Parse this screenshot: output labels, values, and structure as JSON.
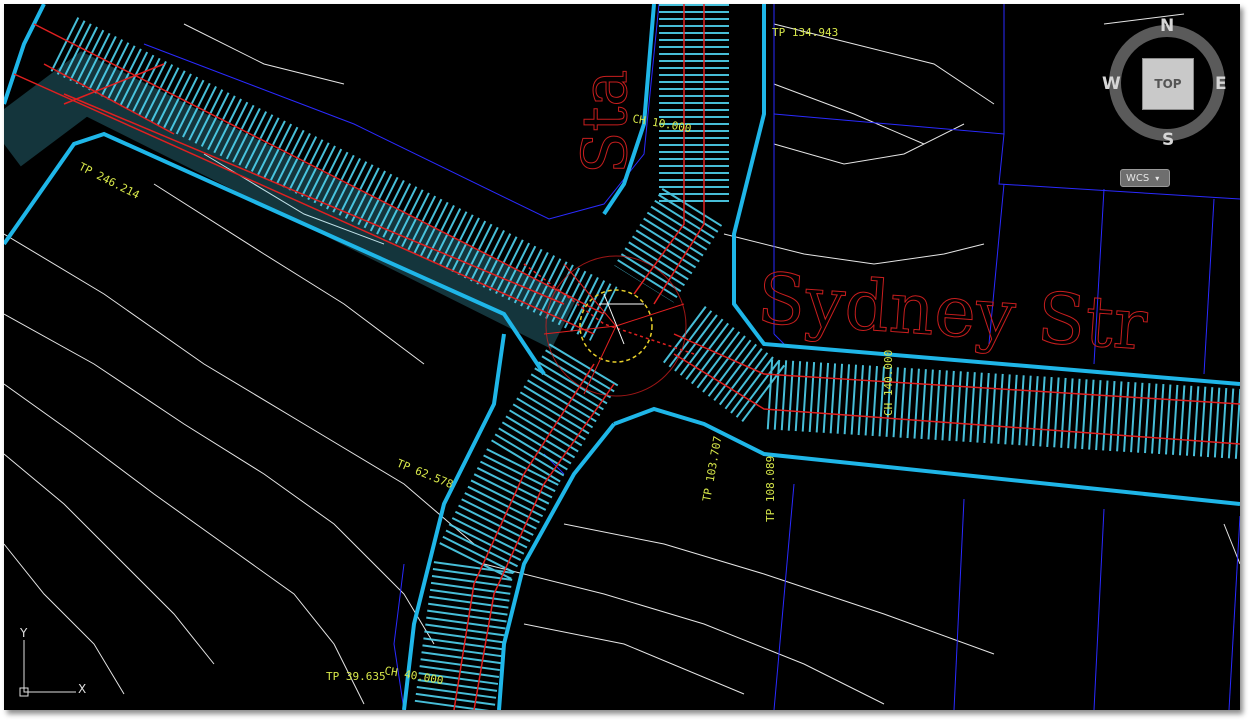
{
  "street_labels": {
    "sydney": "Sydney Str",
    "vertical": "Sta"
  },
  "chainages": [
    {
      "id": "ch-a",
      "text": "CH 10.000"
    },
    {
      "id": "ch-b",
      "text": "CH 40.000"
    },
    {
      "id": "ch-c",
      "text": "CH 140.000"
    }
  ],
  "points": [
    {
      "id": "tp-1",
      "text": "TP 134.943"
    },
    {
      "id": "tp-2",
      "text": "TP 246.214"
    },
    {
      "id": "tp-3",
      "text": "TP 62.578"
    },
    {
      "id": "tp-4",
      "text": "TP 39.635"
    },
    {
      "id": "tp-5",
      "text": "TP 108.089"
    },
    {
      "id": "tp-6",
      "text": "TP 103.707"
    }
  ],
  "viewcube": {
    "north": "N",
    "south": "S",
    "east": "E",
    "west": "W",
    "top_label": "TOP",
    "wcs_label": "WCS"
  },
  "ucs": {
    "x_label": "X",
    "y_label": "Y"
  },
  "colors": {
    "background": "#000000",
    "road_edge": "#1fb6e8",
    "centerline": "#e02020",
    "hatch": "#4fd3f0",
    "text_yellow": "#d8e84a",
    "street_label": "#c81e1e",
    "boundary": "#1a1aff",
    "contour": "#ffffff"
  }
}
